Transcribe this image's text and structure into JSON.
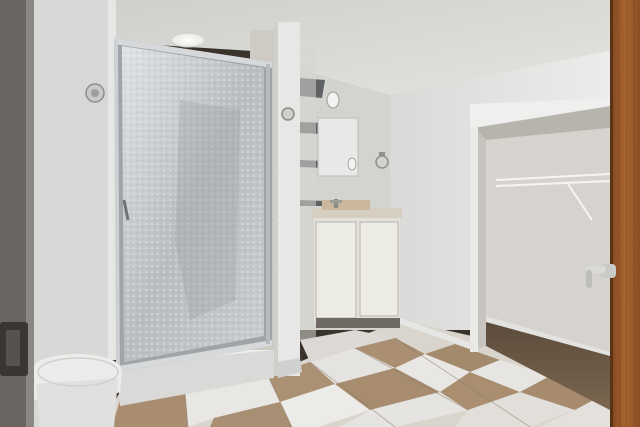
{
  "scene": {
    "kind": "photograph",
    "subject": "bathroom",
    "objects": [
      "ceiling-light",
      "shower-enclosure",
      "frosted-glass-door",
      "shower-knob",
      "toilet",
      "vanity-cabinet",
      "countertop",
      "faucet",
      "mirror",
      "wall-sconce",
      "towel-ring",
      "open-shelves",
      "walk-in-closet",
      "wire-closet-shelf",
      "tile-floor",
      "open-door",
      "door-lever-handle",
      "door-hinge"
    ]
  },
  "colors": {
    "wall": "#dcdcdc",
    "ceiling": "#c9c9c7",
    "floor_tile_light": "#e6e4e0",
    "floor_tile_dark": "#a88f74",
    "door_wood": "#9a5a2c",
    "closet_floor": "#6b5a45",
    "vanity": "#e4e2da"
  }
}
